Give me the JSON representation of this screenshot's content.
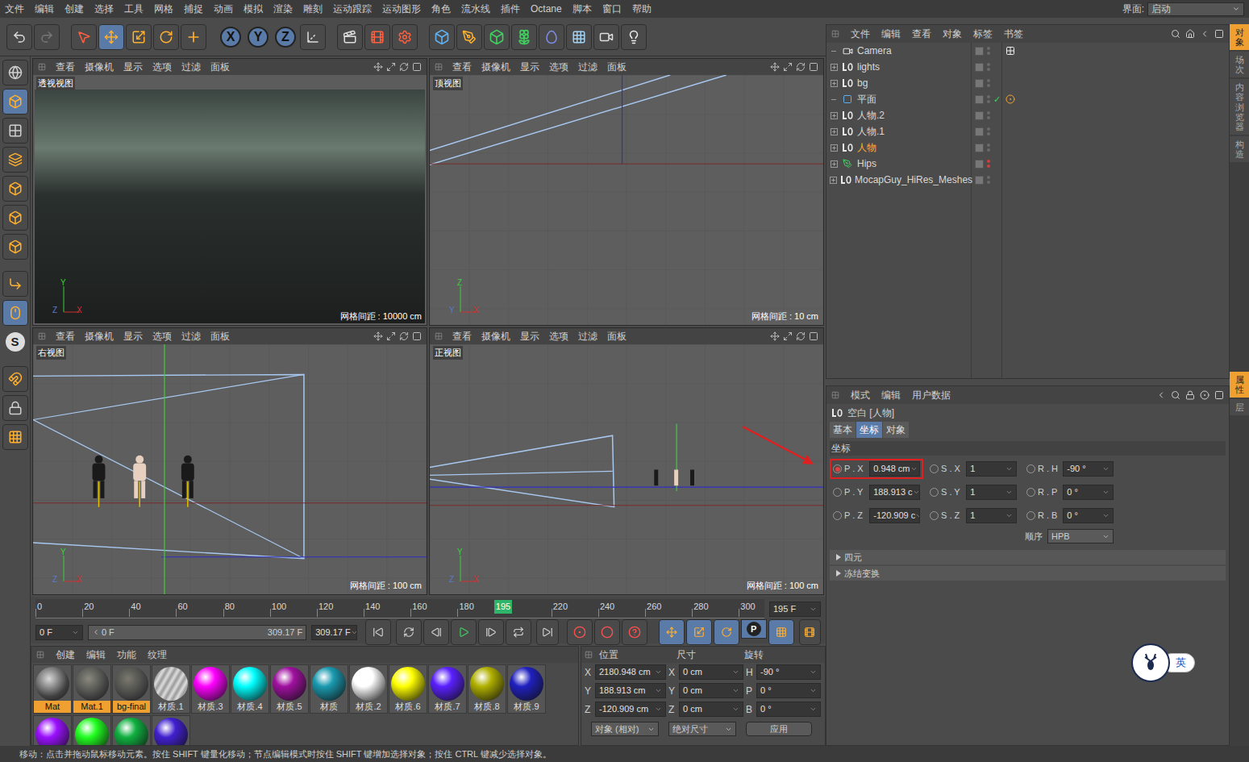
{
  "menubar": {
    "items": [
      "文件",
      "编辑",
      "创建",
      "选择",
      "工具",
      "网格",
      "捕捉",
      "动画",
      "模拟",
      "渲染",
      "雕刻",
      "运动跟踪",
      "运动图形",
      "角色",
      "流水线",
      "插件",
      "Octane",
      "脚本",
      "窗口",
      "帮助"
    ],
    "layout_label": "界面:",
    "layout_value": "启动"
  },
  "toolbar": {
    "axes": [
      "X",
      "Y",
      "Z"
    ]
  },
  "leftbar": {
    "snap_glyph": "S"
  },
  "viewports": [
    {
      "title": "透视视图",
      "kind": "photo",
      "menu": [
        "查看",
        "摄像机",
        "显示",
        "选项",
        "过滤",
        "面板"
      ],
      "grid": "网格间距 : 10000 cm",
      "gizmo": [
        "Y",
        "Z",
        "X"
      ]
    },
    {
      "title": "顶视图",
      "kind": "top",
      "menu": [
        "查看",
        "摄像机",
        "显示",
        "选项",
        "过滤",
        "面板"
      ],
      "grid": "网格间距 : 10 cm",
      "gizmo": [
        "Z",
        "Y",
        "X"
      ]
    },
    {
      "title": "右视图",
      "kind": "right",
      "menu": [
        "查看",
        "摄像机",
        "显示",
        "选项",
        "过滤",
        "面板"
      ],
      "grid": "网格间距 : 100 cm",
      "gizmo": [
        "Y",
        "Z",
        "X"
      ]
    },
    {
      "title": "正视图",
      "kind": "front",
      "menu": [
        "查看",
        "摄像机",
        "显示",
        "选项",
        "过滤",
        "面板"
      ],
      "grid": "网格间距 : 100 cm",
      "gizmo": [
        "Y",
        "Z",
        "X"
      ]
    }
  ],
  "timeline": {
    "ticks": [
      "0",
      "20",
      "40",
      "60",
      "80",
      "100",
      "120",
      "140",
      "160",
      "180",
      "195",
      "220",
      "240",
      "260",
      "280",
      "300"
    ],
    "playhead_tick": "195",
    "level": 0.627,
    "frame_field": "195 F"
  },
  "transport": {
    "start": "0 F",
    "range_start": "0 F",
    "range_end": "309.17 F",
    "end": "309.17 F",
    "param_glyph": "P"
  },
  "materials": {
    "menu": [
      "创建",
      "编辑",
      "功能",
      "纹理"
    ],
    "items": [
      {
        "name": "Mat",
        "kind": "texture",
        "color": "#d8d8d8",
        "selected": true
      },
      {
        "name": "Mat.1",
        "kind": "texture",
        "color": "#8a8a80",
        "selected": true
      },
      {
        "name": "bg-final",
        "kind": "texture",
        "color": "#7a7a70",
        "selected": true
      },
      {
        "name": "材质.1",
        "kind": "glossy",
        "color": "#9a9a9a",
        "selected": false
      },
      {
        "name": "材质.3",
        "kind": "color",
        "color": "#ff00ff",
        "selected": false
      },
      {
        "name": "材质.4",
        "kind": "color",
        "color": "#00ffff",
        "selected": false
      },
      {
        "name": "材质.5",
        "kind": "color",
        "color": "#a010a0",
        "selected": false
      },
      {
        "name": "材质",
        "kind": "color",
        "color": "#1a9ab0",
        "selected": false
      },
      {
        "name": "材质.2",
        "kind": "color",
        "color": "#ffffff",
        "selected": false
      },
      {
        "name": "材质.6",
        "kind": "color",
        "color": "#ffff00",
        "selected": false
      },
      {
        "name": "材质.7",
        "kind": "color",
        "color": "#5a20ff",
        "selected": false
      },
      {
        "name": "材质.8",
        "kind": "color",
        "color": "#b0b000",
        "selected": false
      },
      {
        "name": "材质.9",
        "kind": "color",
        "color": "#2020c0",
        "selected": false
      }
    ],
    "second_row": [
      {
        "color": "#9a10ff"
      },
      {
        "color": "#20ff20"
      },
      {
        "color": "#10b040"
      },
      {
        "color": "#4020d0"
      }
    ]
  },
  "coordinates": {
    "headers": [
      "位置",
      "尺寸",
      "旋转"
    ],
    "rows": [
      {
        "axis": "X",
        "position": "2180.948 cm",
        "size_axis": "X",
        "size": "0 cm",
        "rot_axis": "H",
        "rotation": "-90 °"
      },
      {
        "axis": "Y",
        "position": "188.913 cm",
        "size_axis": "Y",
        "size": "0 cm",
        "rot_axis": "P",
        "rotation": "0 °"
      },
      {
        "axis": "Z",
        "position": "-120.909 cm",
        "size_axis": "Z",
        "size": "0 cm",
        "rot_axis": "B",
        "rotation": "0 °"
      }
    ],
    "mode": "对象 (相对)",
    "size_mode": "绝对尺寸",
    "apply": "应用"
  },
  "objects": {
    "menu": [
      "文件",
      "编辑",
      "查看",
      "对象",
      "标签",
      "书签"
    ],
    "items": [
      {
        "name": "Camera",
        "icon": "camera",
        "has_children": false,
        "selected": false,
        "check": false,
        "tag": true,
        "dot_color": "#6a6a6a"
      },
      {
        "name": "lights",
        "icon": "null",
        "has_children": true,
        "selected": false,
        "check": false,
        "tag": false,
        "dot_color": "#6a6a6a"
      },
      {
        "name": "bg",
        "icon": "null",
        "has_children": true,
        "selected": false,
        "check": false,
        "tag": false,
        "dot_color": "#6a6a6a"
      },
      {
        "name": "平面",
        "icon": "plane",
        "has_children": false,
        "selected": false,
        "check": true,
        "tag": true,
        "dot_color": "#6a6a6a"
      },
      {
        "name": "人物.2",
        "icon": "null",
        "has_children": true,
        "selected": false,
        "check": false,
        "tag": false,
        "dot_color": "#6a6a6a"
      },
      {
        "name": "人物.1",
        "icon": "null",
        "has_children": true,
        "selected": false,
        "check": false,
        "tag": false,
        "dot_color": "#6a6a6a"
      },
      {
        "name": "人物",
        "icon": "null",
        "has_children": true,
        "selected": true,
        "check": false,
        "tag": false,
        "dot_color": "#6a6a6a"
      },
      {
        "name": "Hips",
        "icon": "joint",
        "has_children": true,
        "selected": false,
        "check": false,
        "tag": false,
        "dot_color": "#d04040"
      },
      {
        "name": "MocapGuy_HiRes_Meshes",
        "icon": "null",
        "has_children": true,
        "selected": false,
        "check": false,
        "tag": false,
        "dot_color": "#6a6a6a"
      }
    ]
  },
  "attributes": {
    "menu": [
      "模式",
      "编辑",
      "用户数据"
    ],
    "title": "空白 [人物]",
    "tabs": [
      {
        "label": "基本",
        "selected": false
      },
      {
        "label": "坐标",
        "selected": true
      },
      {
        "label": "对象",
        "selected": false
      }
    ],
    "section": "坐标",
    "rows": [
      [
        {
          "label": "P . X",
          "value": "0.948 cm",
          "highlighted": true,
          "active": true
        },
        {
          "label": "S . X",
          "value": "1",
          "highlighted": false,
          "active": false
        },
        {
          "label": "R . H",
          "value": "-90 °",
          "highlighted": false,
          "active": false
        }
      ],
      [
        {
          "label": "P . Y",
          "value": "188.913 c",
          "highlighted": false,
          "active": false
        },
        {
          "label": "S . Y",
          "value": "1",
          "highlighted": false,
          "active": false
        },
        {
          "label": "R . P",
          "value": "0 °",
          "highlighted": false,
          "active": false
        }
      ],
      [
        {
          "label": "P . Z",
          "value": "-120.909 c",
          "highlighted": false,
          "active": false
        },
        {
          "label": "S . Z",
          "value": "1",
          "highlighted": false,
          "active": false
        },
        {
          "label": "R . B",
          "value": "0 °",
          "highlighted": false,
          "active": false
        }
      ]
    ],
    "order_label": "顺序",
    "order_value": "HPB",
    "groups": [
      {
        "label": "四元",
        "expanded": false
      },
      {
        "label": "冻结变换",
        "expanded": false
      }
    ]
  },
  "side_tabs_top": [
    {
      "label": "对象",
      "selected": true
    },
    {
      "label": "场次",
      "selected": false
    },
    {
      "label": "内容浏览器",
      "selected": false
    },
    {
      "label": "构造",
      "selected": false
    }
  ],
  "side_tabs_bottom": [
    {
      "label": "属性",
      "selected": true
    },
    {
      "label": "层",
      "selected": false
    }
  ],
  "status_bar": "移动：点击并拖动鼠标移动元素。按住 SHIFT 键量化移动；节点编辑模式时按住 SHIFT 键增加选择对象；按住 CTRL 键减少选择对象。",
  "ime_badge": "英"
}
